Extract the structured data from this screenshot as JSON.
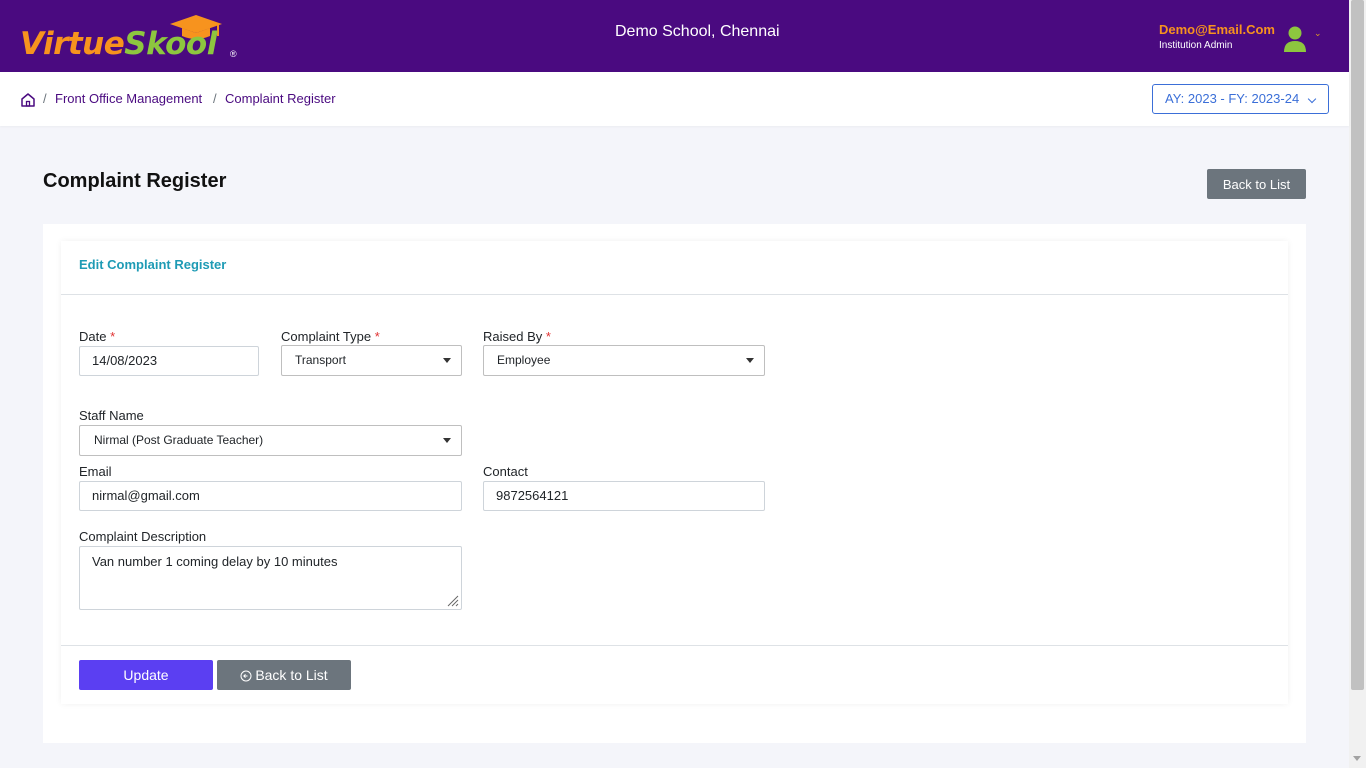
{
  "header": {
    "logo_part1": "Virtue",
    "logo_part2": "Skool",
    "logo_reg": "®",
    "school_name": "Demo School, Chennai",
    "user_email": "Demo@Email.Com",
    "user_role": "Institution Admin"
  },
  "breadcrumb": {
    "items": [
      "Front Office Management",
      "Complaint Register"
    ],
    "separator": "/"
  },
  "academic_year": "AY: 2023 - FY: 2023-24",
  "page": {
    "title": "Complaint Register",
    "back_to_list": "Back to List"
  },
  "form": {
    "card_title": "Edit Complaint Register",
    "required_mark": "*",
    "date": {
      "label": "Date",
      "value": "14/08/2023"
    },
    "complaint_type": {
      "label": "Complaint Type",
      "value": "Transport"
    },
    "raised_by": {
      "label": "Raised By",
      "value": "Employee"
    },
    "staff_name": {
      "label": "Staff Name",
      "value": "Nirmal (Post Graduate Teacher)"
    },
    "email": {
      "label": "Email",
      "value": "nirmal@gmail.com"
    },
    "contact": {
      "label": "Contact",
      "value": "9872564121"
    },
    "description": {
      "label": "Complaint Description",
      "value": "Van number 1 coming delay by 10 minutes"
    },
    "update_button": "Update",
    "back_button": "Back to List"
  },
  "colors": {
    "header_bg": "#4a0a80",
    "logo_orange": "#f7931e",
    "logo_green": "#8dc63f",
    "primary_button": "#5b3ff2",
    "secondary_button": "#6c757d",
    "card_title": "#1e9bb5",
    "required": "#e03131"
  },
  "icons": [
    "graduation-cap-icon",
    "user-avatar-icon",
    "chevron-down-icon",
    "home-icon",
    "circle-arrow-left-icon",
    "resize-grip-icon"
  ]
}
